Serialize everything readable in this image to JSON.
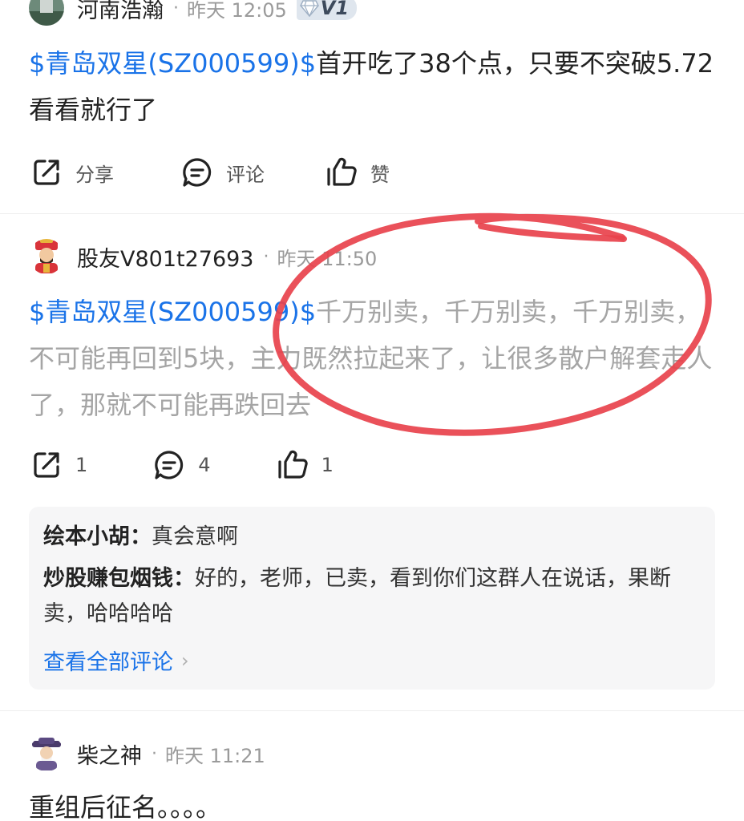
{
  "colors": {
    "link": "#1a73e8",
    "annotation": "#e8424c"
  },
  "posts": [
    {
      "author": "河南浩瀚",
      "dot": "·",
      "time": "昨天 12:05",
      "badge": "V1",
      "stock": "$青岛双星(SZ000599)$",
      "text": "首开吃了38个点，只要不突破5.72看看就行了",
      "actions": {
        "share": "分享",
        "comment": "评论",
        "like": "赞"
      }
    },
    {
      "author": "股友V801t27693",
      "dot": "·",
      "time": "昨天 11:50",
      "stock": "$青岛双星(SZ000599)$",
      "text": "千万别卖，千万别卖，千万别卖，不可能再回到5块，主力既然拉起来了，让很多散户解套走人了，那就不可能再跌回去",
      "actions": {
        "share": "1",
        "comment": "4",
        "like": "1"
      },
      "comments": [
        {
          "author": "绘本小胡：",
          "text": "真会意啊"
        },
        {
          "author": "炒股赚包烟钱：",
          "text": "好的，老师，已卖，看到你们这群人在说话，果断卖，哈哈哈哈"
        }
      ],
      "view_all": "查看全部评论",
      "view_all_chevron": "›"
    },
    {
      "author": "柴之神",
      "dot": "·",
      "time": "昨天 11:21",
      "text": "重组后征名。。。。"
    }
  ]
}
